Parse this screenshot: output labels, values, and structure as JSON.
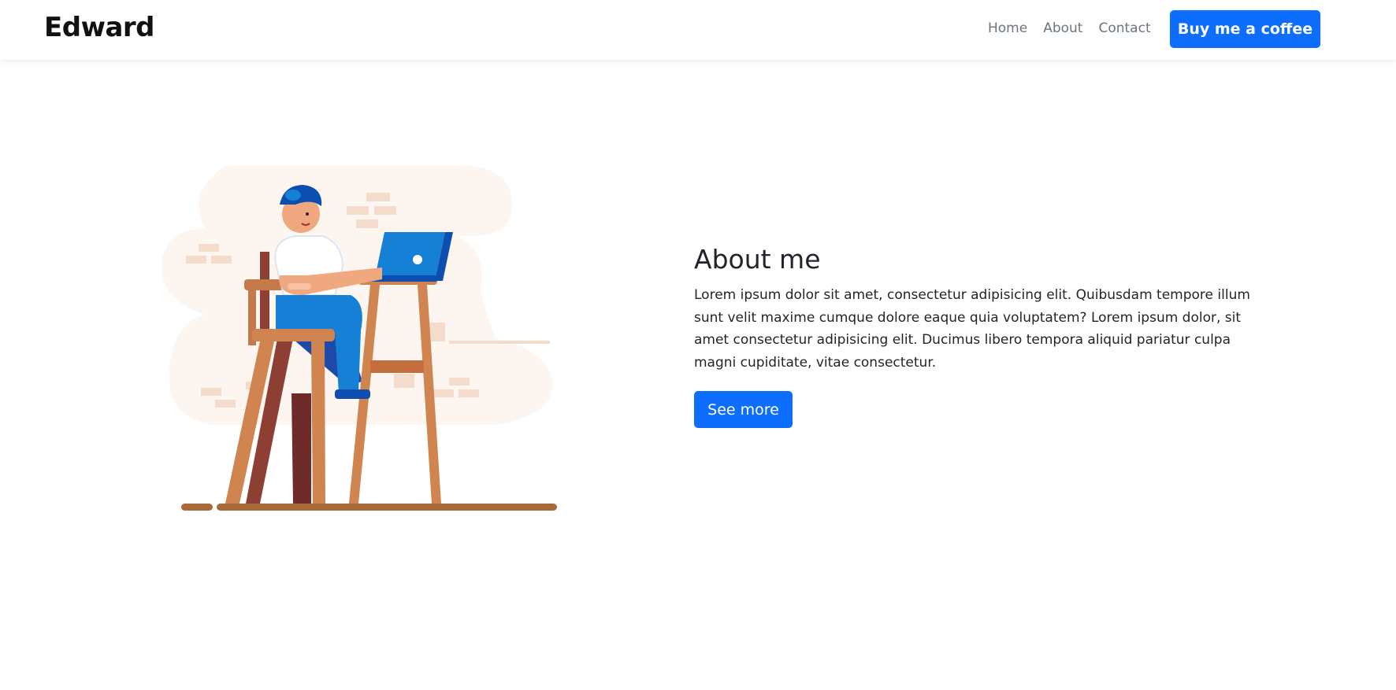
{
  "navbar": {
    "brand": "Edward",
    "links": [
      "Home",
      "About",
      "Contact"
    ],
    "cta_label": "Buy me a coffee"
  },
  "about": {
    "title": "About me",
    "body": "Lorem ipsum dolor sit amet, consectetur adipisicing elit. Quibusdam tempore illum sunt velit maxime cumque dolore eaque quia voluptatem? Lorem ipsum dolor, sit amet consectetur adipisicing elit. Ducimus libero tempora aliquid pariatur culpa magni cupiditate, vitae consectetur.",
    "button_label": "See more"
  },
  "colors": {
    "accent": "#0d6efd",
    "text": "#212529",
    "muted": "#6c757d"
  },
  "illustration": {
    "icon": "person-with-laptop-illustration"
  }
}
